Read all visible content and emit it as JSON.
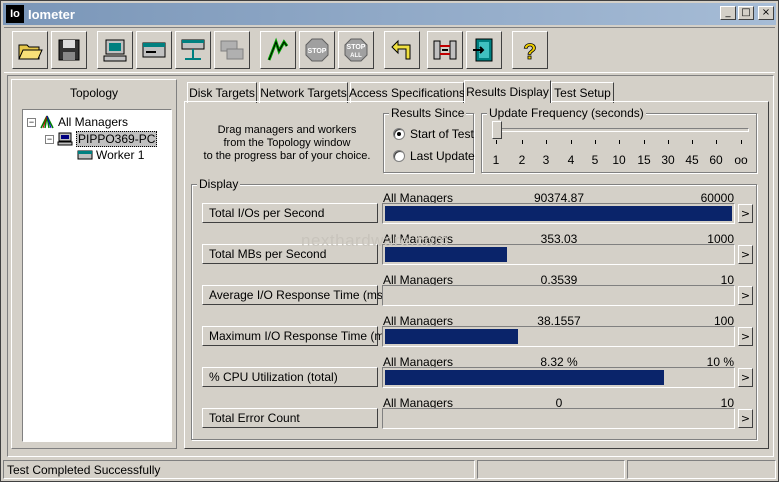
{
  "window": {
    "title": "Iometer",
    "logo_text": "Io"
  },
  "title_buttons": {
    "minimize": "_",
    "maximize": "□",
    "close": "×"
  },
  "toolbar": {
    "buttons": [
      {
        "name": "open-config-button",
        "icon": "folder-open-icon"
      },
      {
        "name": "save-config-button",
        "icon": "floppy-disk-icon"
      },
      {
        "name": "start-new-manager-button",
        "icon": "computer-icon"
      },
      {
        "name": "start-disk-worker-button",
        "icon": "disk-worker-icon"
      },
      {
        "name": "start-network-worker-button",
        "icon": "network-worker-icon"
      },
      {
        "name": "duplicate-worker-button",
        "icon": "duplicate-icon"
      },
      {
        "name": "start-tests-button",
        "icon": "green-flag-icon"
      },
      {
        "name": "stop-button",
        "icon": "stop-sign-icon",
        "label": "STOP"
      },
      {
        "name": "stop-all-button",
        "icon": "stop-all-sign-icon",
        "label": "STOP",
        "label2": "ALL"
      },
      {
        "name": "reset-workers-button",
        "icon": "reset-arrow-icon"
      },
      {
        "name": "disconnect-button",
        "icon": "disconnect-icon"
      },
      {
        "name": "exit-button",
        "icon": "exit-door-icon"
      },
      {
        "name": "about-button",
        "icon": "question-mark-icon",
        "label": "?"
      }
    ]
  },
  "topology": {
    "title": "Topology",
    "nodes": [
      {
        "label": "All Managers",
        "expander": "−",
        "icon": "all-managers-icon"
      },
      {
        "label": "PIPPO369-PC",
        "expander": "−",
        "icon": "manager-computer-icon"
      },
      {
        "label": "Worker 1",
        "icon": "worker-disk-icon"
      }
    ]
  },
  "tabs": [
    {
      "label": "Disk Targets"
    },
    {
      "label": "Network Targets"
    },
    {
      "label": "Access Specifications"
    },
    {
      "label": "Results Display",
      "active": true
    },
    {
      "label": "Test Setup"
    }
  ],
  "drag_instructions": [
    "Drag managers and workers",
    "from the Topology window",
    "to the progress bar of your choice."
  ],
  "results_since": {
    "title": "Results Since",
    "options": [
      {
        "label": "Start of Test",
        "selected": true
      },
      {
        "label": "Last Update",
        "selected": false
      }
    ]
  },
  "update_frequency": {
    "title": "Update Frequency (seconds)",
    "ticks": [
      "1",
      "2",
      "3",
      "4",
      "5",
      "10",
      "15",
      "30",
      "45",
      "60",
      "oo"
    ],
    "selected_index": 0
  },
  "display": {
    "title": "Display",
    "metrics": [
      {
        "button": "Total I/Os per Second",
        "source": "All Managers",
        "value": "90374.87",
        "max": "60000",
        "fill": 1.0
      },
      {
        "button": "Total MBs per Second",
        "source": "All Managers",
        "value": "353.03",
        "max": "1000",
        "fill": 0.353
      },
      {
        "button": "Average I/O Response Time (ms)",
        "source": "All Managers",
        "value": "0.3539",
        "max": "10",
        "fill": 0.0
      },
      {
        "button": "Maximum I/O Response Time (ms)",
        "source": "All Managers",
        "value": "38.1557",
        "max": "100",
        "fill": 0.382
      },
      {
        "button": "% CPU Utilization (total)",
        "source": "All Managers",
        "value": "8.32 %",
        "max": "10 %",
        "fill": 0.805
      },
      {
        "button": "Total Error Count",
        "source": "All Managers",
        "value": "0",
        "max": "10",
        "fill": 0.0
      }
    ],
    "arrow": ">"
  },
  "watermark": "nexthardware.com",
  "status": {
    "message": "Test Completed Successfully"
  },
  "colors": {
    "bar": "#0a246a",
    "title_start": "#7a96b8",
    "title_end": "#a6bcd6"
  }
}
